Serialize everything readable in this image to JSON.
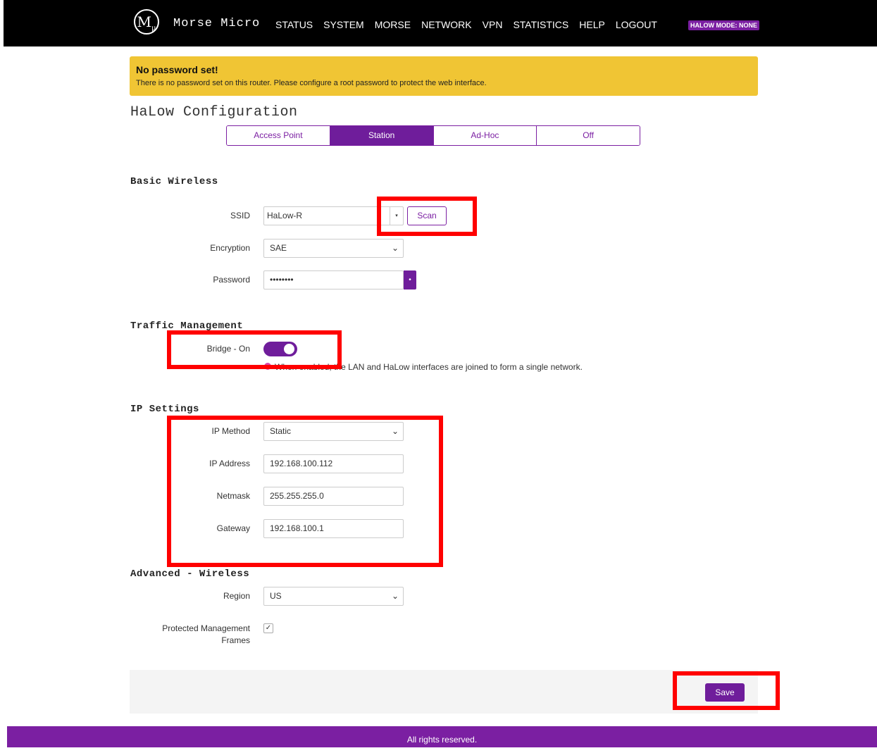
{
  "brand": {
    "logo_letter": "M",
    "logo_sub": "μ",
    "name": "Morse Micro"
  },
  "nav": [
    "STATUS",
    "SYSTEM",
    "MORSE",
    "NETWORK",
    "VPN",
    "STATISTICS",
    "HELP",
    "LOGOUT"
  ],
  "mode_badge": "HALOW MODE: NONE",
  "alert": {
    "title": "No password set!",
    "text": "There is no password set on this router. Please configure a root password to protect the web interface."
  },
  "page_title": "HaLow Configuration",
  "tabs": [
    {
      "label": "Access Point",
      "active": false
    },
    {
      "label": "Station",
      "active": true
    },
    {
      "label": "Ad-Hoc",
      "active": false
    },
    {
      "label": "Off",
      "active": false
    }
  ],
  "basic_wireless": {
    "title": "Basic Wireless",
    "ssid_label": "SSID",
    "ssid_value": "HaLow-R",
    "scan_label": "Scan",
    "encryption_label": "Encryption",
    "encryption_value": "SAE",
    "password_label": "Password",
    "password_value": "••••••••"
  },
  "traffic": {
    "title": "Traffic Management",
    "bridge_label": "Bridge - On",
    "bridge_on": true,
    "help_text": "When enabled, the LAN and HaLow interfaces are joined to form a single network."
  },
  "ip_settings": {
    "title": "IP Settings",
    "method_label": "IP Method",
    "method_value": "Static",
    "address_label": "IP Address",
    "address_value": "192.168.100.112",
    "netmask_label": "Netmask",
    "netmask_value": "255.255.255.0",
    "gateway_label": "Gateway",
    "gateway_value": "192.168.100.1"
  },
  "advanced": {
    "title": "Advanced - Wireless",
    "region_label": "Region",
    "region_value": "US",
    "pmf_label_1": "Protected Management",
    "pmf_label_2": "Frames",
    "pmf_checked": true
  },
  "save_label": "Save",
  "footer_text": "All rights reserved.",
  "colors": {
    "accent": "#6f1d9b",
    "alert": "#f0c534",
    "highlight": "#ff0000"
  }
}
